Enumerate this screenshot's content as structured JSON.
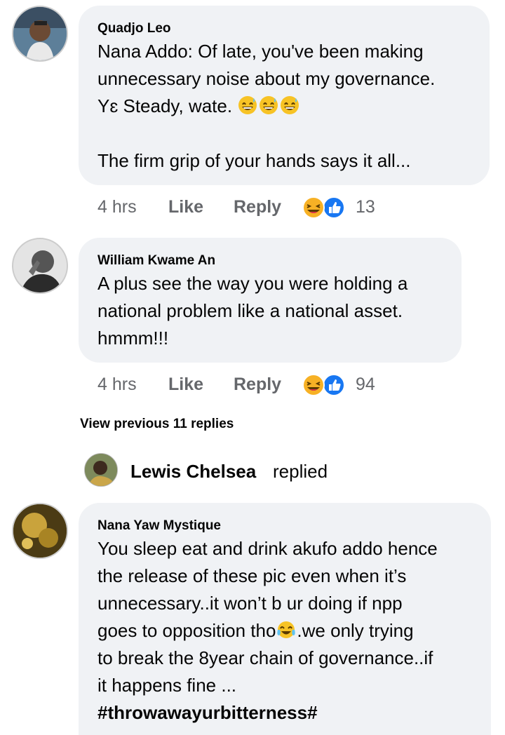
{
  "comments": [
    {
      "author": "Quadjo Leo",
      "lines": [
        "Nana Addo: Of late, you've been making",
        "unnecessary noise about my governance.",
        "Yɛ Steady, wate."
      ],
      "line_end": "The firm grip of your hands says it all...",
      "time": "4 hrs",
      "like": "Like",
      "reply": "Reply",
      "reaction_count": "13",
      "reaction_icons": [
        "laugh-icon",
        "like-icon"
      ]
    },
    {
      "author": "William Kwame An",
      "lines": [
        "A plus see the way you  were holding a",
        "national problem like a national asset.",
        "hmmm!!!"
      ],
      "time": "4 hrs",
      "like": "Like",
      "reply": "Reply",
      "reaction_count": "94",
      "reaction_icons": [
        "laugh-icon",
        "like-icon"
      ]
    }
  ],
  "view_previous": "View previous 11 replies",
  "last_reply": {
    "name": "Lewis Chelsea",
    "word": "replied"
  },
  "comment3": {
    "author": "Nana Yaw Mystique",
    "l1": "You sleep eat and drink akufo addo hence",
    "l2": "the release of these pic even when it’s",
    "l3": "unnecessary..it won’t b ur doing if npp",
    "l4a": "goes to opposition tho",
    "l4b": ".we only trying",
    "l5": "to break the 8year chain of governance..if",
    "l6": "it happens fine ...",
    "tag": "#throwawayurbitterness#"
  },
  "colors": {
    "bubble": "#f0f2f5",
    "meta": "#65676b",
    "like_blue": "#1877f2",
    "emoji_yellow": "#f7b125"
  }
}
